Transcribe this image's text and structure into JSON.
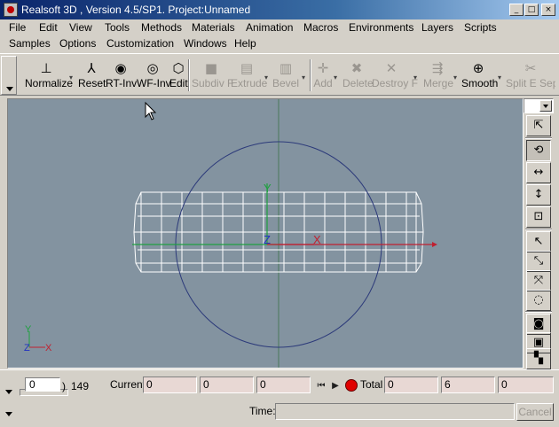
{
  "window": {
    "title": "Realsoft 3D , Version 4.5/SP1. Project:Unnamed",
    "minimize": "_",
    "maximize": "□",
    "close": "×"
  },
  "menu": {
    "row1": [
      "File",
      "Edit",
      "View",
      "Tools",
      "Methods",
      "Materials",
      "Animation",
      "Macros",
      "Environments",
      "Layers",
      "Scripts"
    ],
    "row2": [
      "Samples",
      "Options",
      "Customization",
      "Windows",
      "Help"
    ]
  },
  "toolbar": {
    "buttons": [
      {
        "label": "Normalize",
        "icon": "axes-icon",
        "glyph": "⊥",
        "enabled": true
      },
      {
        "label": "Reset",
        "icon": "reset-axes-icon",
        "glyph": "⅄",
        "enabled": true
      },
      {
        "label": "RT-Inv",
        "icon": "eye-icon",
        "glyph": "◉",
        "enabled": true
      },
      {
        "label": "WF-Inv",
        "icon": "eye-wire-icon",
        "glyph": "◎",
        "enabled": true
      },
      {
        "label": "Edit",
        "icon": "cube-edit-icon",
        "glyph": "⬡",
        "enabled": true
      },
      {
        "label": "Subdiv F",
        "icon": "subdivide-icon",
        "glyph": "■",
        "enabled": false
      },
      {
        "label": "Extrude",
        "icon": "extrude-icon",
        "glyph": "▤",
        "enabled": false
      },
      {
        "label": "Bevel",
        "icon": "bevel-icon",
        "glyph": "▥",
        "enabled": false
      },
      {
        "label": "Add",
        "icon": "add-icon",
        "glyph": "✛",
        "enabled": false
      },
      {
        "label": "Delete",
        "icon": "delete-icon",
        "glyph": "✖",
        "enabled": false
      },
      {
        "label": "Destroy F",
        "icon": "destroy-icon",
        "glyph": "✕",
        "enabled": false
      },
      {
        "label": "Merge",
        "icon": "merge-icon",
        "glyph": "⇶",
        "enabled": false
      },
      {
        "label": "Smooth",
        "icon": "sphere-icon",
        "glyph": "⊕",
        "enabled": true
      },
      {
        "label": "Split E Sep",
        "icon": "split-icon",
        "glyph": "✂",
        "enabled": false
      }
    ]
  },
  "viewport": {
    "axis_labels": {
      "x": "X",
      "y": "Y",
      "z": "Z"
    },
    "colors": {
      "background": "#8393a0",
      "wireframe": "#ffffff",
      "circle": "#2c3a7a",
      "x_axis": "#c02030",
      "y_axis": "#20a040",
      "z_axis": "#2030c0"
    }
  },
  "right_panel": {
    "buttons": [
      {
        "name": "select-arrow-icon",
        "glyph": "⇱"
      },
      {
        "name": "rotate-camera-icon",
        "glyph": "⟲"
      },
      {
        "name": "pan-camera-icon",
        "glyph": "↔"
      },
      {
        "name": "dolly-camera-icon",
        "glyph": "↕"
      },
      {
        "name": "zoom-camera-icon",
        "glyph": "⊡"
      },
      {
        "name": "pointer-icon",
        "glyph": "↖"
      },
      {
        "name": "add-pointer-icon",
        "glyph": "⤡"
      },
      {
        "name": "multi-pointer-icon",
        "glyph": "⤧"
      },
      {
        "name": "lasso-icon",
        "glyph": "◌"
      },
      {
        "name": "camera-icon",
        "glyph": "◙"
      },
      {
        "name": "render-view-icon",
        "glyph": "▣"
      },
      {
        "name": "paint-roller-icon",
        "glyph": "▚"
      }
    ]
  },
  "timeline": {
    "slider_value": "0",
    "end_frame": "149",
    "current_label": "Current",
    "current_values": [
      "0",
      "0",
      "0"
    ],
    "total_label": "Total",
    "total_values": [
      "0",
      "6",
      "0"
    ]
  },
  "status": {
    "time_label": "Time:",
    "time_value": "",
    "cancel_label": "Cancel"
  }
}
